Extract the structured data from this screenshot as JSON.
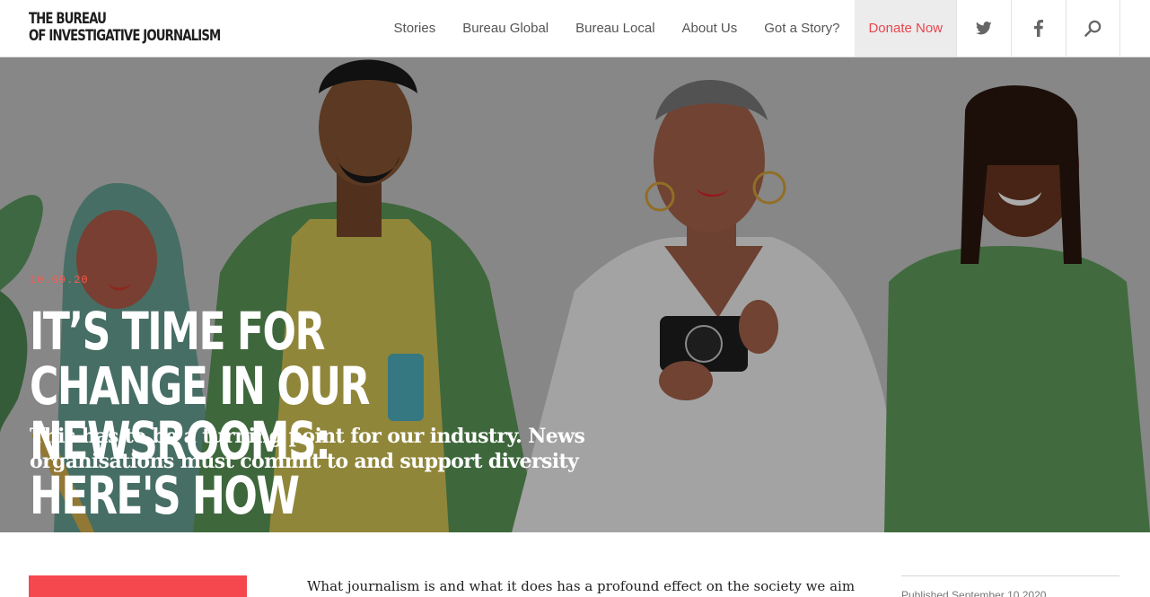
{
  "brand": {
    "line1": "THE BUREAU",
    "line2": "OF INVESTIGATIVE JOURNALISM"
  },
  "nav": {
    "items": [
      "Stories",
      "Bureau Global",
      "Bureau Local",
      "About Us",
      "Got a Story?"
    ],
    "donate": "Donate Now",
    "icons": [
      "twitter-icon",
      "facebook-icon",
      "search-icon"
    ]
  },
  "article": {
    "date": "10.09.20",
    "title": "IT’S TIME FOR CHANGE IN OUR NEWSROOMS: HERE'S HOW",
    "subtitle": "This has to be a turning point for our industry. News organisations must commit to and support diversity",
    "intro": "What journalism is and what it does has a profound effect on the society we aim",
    "published": "Published September 10 2020"
  },
  "colors": {
    "accent": "#e8474e",
    "date": "#ff5a4c",
    "red_block": "#f5474e"
  }
}
